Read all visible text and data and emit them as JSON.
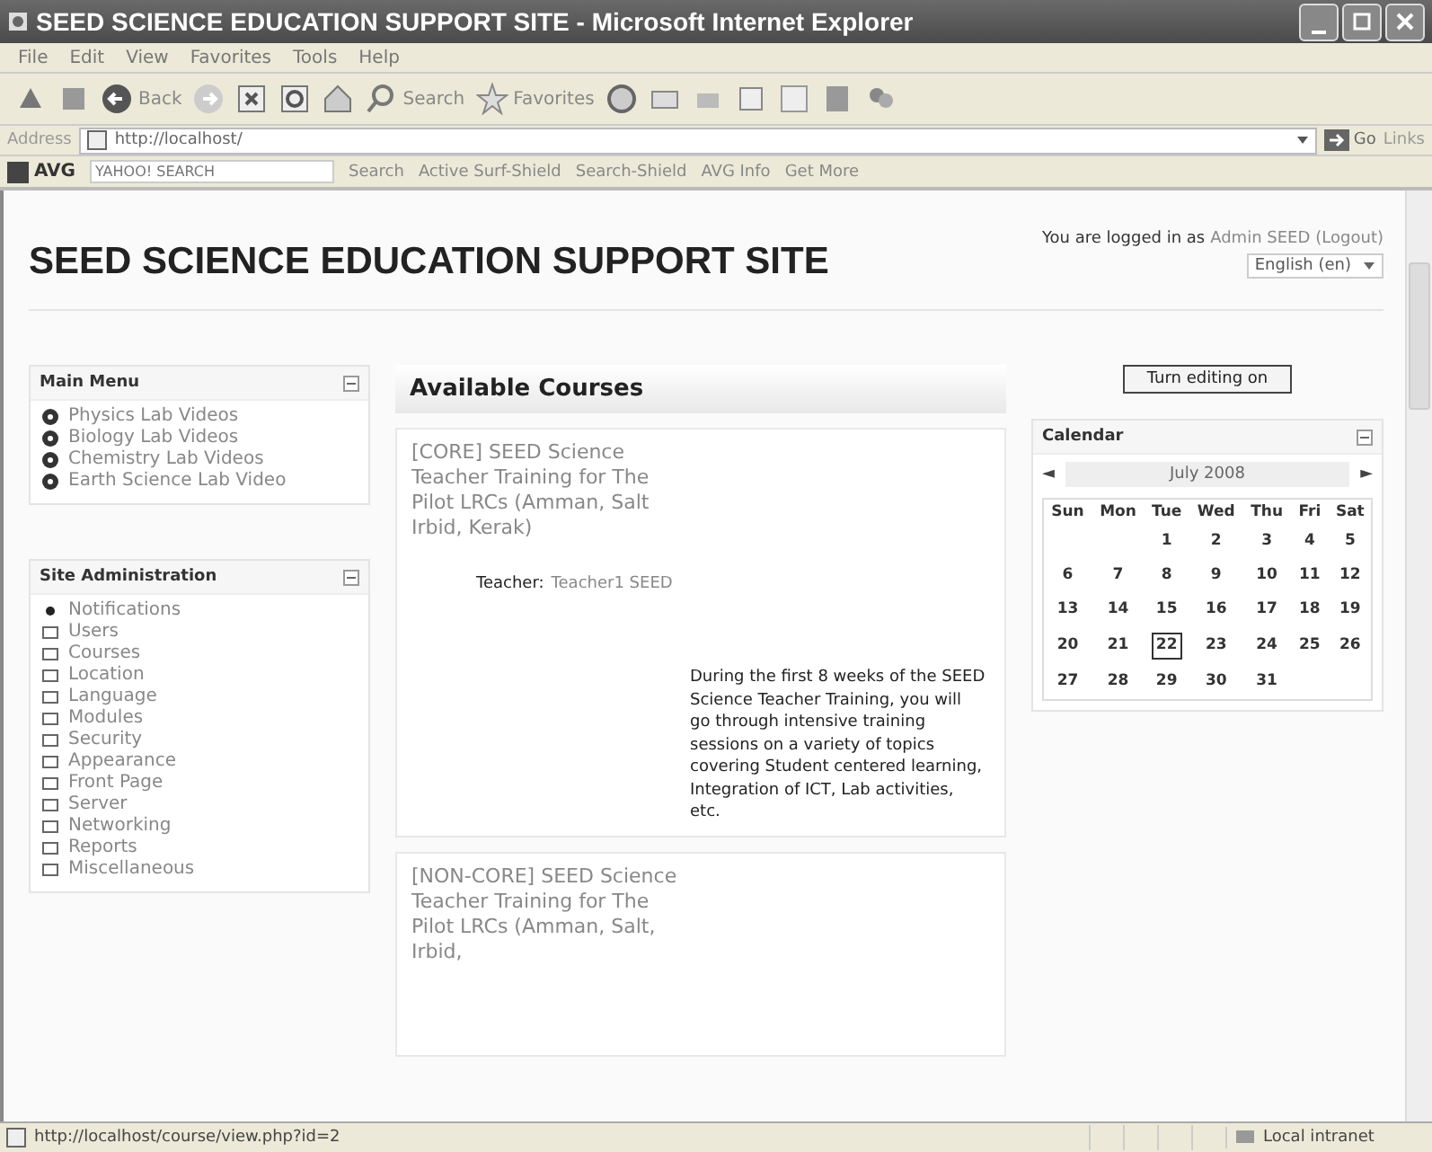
{
  "window": {
    "title": "SEED SCIENCE EDUCATION SUPPORT SITE - Microsoft Internet Explorer"
  },
  "menu_bar": [
    "File",
    "Edit",
    "View",
    "Favorites",
    "Tools",
    "Help"
  ],
  "toolbar": {
    "back": "Back",
    "search": "Search",
    "favorites": "Favorites"
  },
  "address_bar": {
    "label": "Address",
    "value": "http://localhost/",
    "go": "Go",
    "links": "Links"
  },
  "avg_toolbar": {
    "brand": "AVG",
    "placeholder": "YAHOO! SEARCH",
    "items": [
      "Search",
      "Active Surf-Shield",
      "Search-Shield",
      "AVG Info",
      "Get More"
    ]
  },
  "page": {
    "site_title": "SEED SCIENCE EDUCATION SUPPORT SITE",
    "login_text": "You are logged in as",
    "user": "Admin SEED",
    "logout": "(Logout)",
    "language": "English (en)",
    "main_menu": {
      "title": "Main Menu",
      "items": [
        "Physics Lab Videos",
        "Biology Lab Videos",
        "Chemistry Lab Videos",
        "Earth Science Lab Video"
      ]
    },
    "site_admin": {
      "title": "Site Administration",
      "items": [
        {
          "label": "Notifications",
          "kind": "bullet"
        },
        {
          "label": "Users",
          "kind": "folder"
        },
        {
          "label": "Courses",
          "kind": "folder"
        },
        {
          "label": "Location",
          "kind": "folder"
        },
        {
          "label": "Language",
          "kind": "folder"
        },
        {
          "label": "Modules",
          "kind": "folder"
        },
        {
          "label": "Security",
          "kind": "folder"
        },
        {
          "label": "Appearance",
          "kind": "folder"
        },
        {
          "label": "Front Page",
          "kind": "folder"
        },
        {
          "label": "Server",
          "kind": "folder"
        },
        {
          "label": "Networking",
          "kind": "folder"
        },
        {
          "label": "Reports",
          "kind": "folder"
        },
        {
          "label": "Miscellaneous",
          "kind": "folder"
        }
      ]
    },
    "courses": {
      "title": "Available Courses",
      "items": [
        {
          "name": "[CORE] SEED Science Teacher Training for The Pilot LRCs (Amman, Salt Irbid, Kerak)",
          "teacher_label": "Teacher:",
          "teacher": "Teacher1 SEED",
          "summary": "During the first 8 weeks of the SEED Science Teacher Training, you will go through intensive training sessions on a variety of topics covering Student centered learning, Integration of ICT, Lab activities, etc."
        },
        {
          "name": "[NON-CORE] SEED Science Teacher Training for The Pilot LRCs (Amman, Salt, Irbid,"
        }
      ]
    },
    "edit_button": "Turn editing on",
    "calendar": {
      "title": "Calendar",
      "prev": "◄",
      "month": "July 2008",
      "next": "►",
      "weekdays": [
        "Sun",
        "Mon",
        "Tue",
        "Wed",
        "Thu",
        "Fri",
        "Sat"
      ],
      "weeks": [
        {
          "kind": "end_aligned",
          "days": [
            {
              "day": "1",
              "today": false
            },
            {
              "day": "2",
              "today": false
            },
            {
              "day": "3",
              "today": false
            },
            {
              "day": "4",
              "today": false
            },
            {
              "day": "5",
              "today": false
            }
          ]
        },
        {
          "kind": "full",
          "days": [
            {
              "day": "6",
              "today": false
            },
            {
              "day": "7",
              "today": false
            },
            {
              "day": "8",
              "today": false
            },
            {
              "day": "9",
              "today": false
            },
            {
              "day": "10",
              "today": false
            },
            {
              "day": "11",
              "today": false
            },
            {
              "day": "12",
              "today": false
            }
          ]
        },
        {
          "kind": "full",
          "days": [
            {
              "day": "13",
              "today": false
            },
            {
              "day": "14",
              "today": false
            },
            {
              "day": "15",
              "today": false
            },
            {
              "day": "16",
              "today": false
            },
            {
              "day": "17",
              "today": false
            },
            {
              "day": "18",
              "today": false
            },
            {
              "day": "19",
              "today": false
            }
          ]
        },
        {
          "kind": "full",
          "days": [
            {
              "day": "20",
              "today": false
            },
            {
              "day": "21",
              "today": false
            },
            {
              "day": "22",
              "today": true
            },
            {
              "day": "23",
              "today": false
            },
            {
              "day": "24",
              "today": false
            },
            {
              "day": "25",
              "today": false
            },
            {
              "day": "26",
              "today": false
            }
          ]
        },
        {
          "kind": "start_aligned",
          "days": [
            {
              "day": "27",
              "today": false
            },
            {
              "day": "28",
              "today": false
            },
            {
              "day": "29",
              "today": false
            },
            {
              "day": "30",
              "today": false
            },
            {
              "day": "31",
              "today": false
            }
          ]
        }
      ]
    }
  },
  "status_bar": {
    "url": "http://localhost/course/view.php?id=2",
    "zone": "Local intranet"
  }
}
